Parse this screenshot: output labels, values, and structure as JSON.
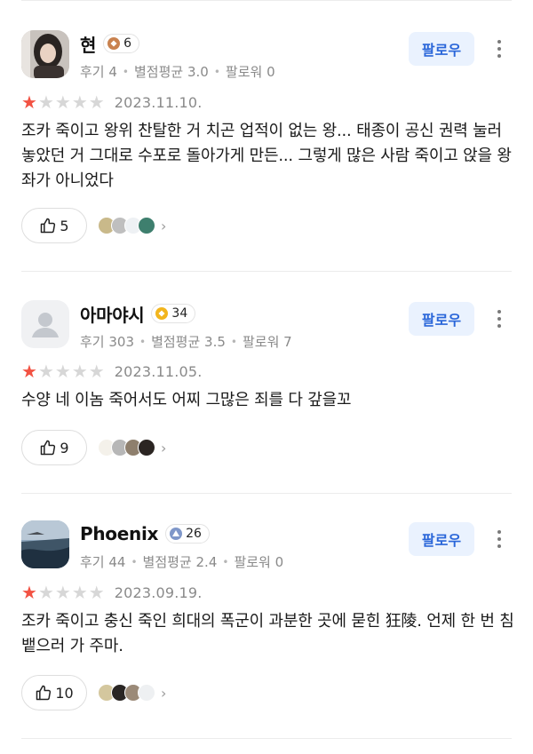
{
  "reviews": [
    {
      "username": "현",
      "level": "6",
      "level_color": "#c9824f",
      "stats": {
        "reviews": "후기 4",
        "avg": "별점평균 3.0",
        "followers": "팔로워 0"
      },
      "follow_label": "팔로우",
      "rating": 1,
      "date": "2023.11.10.",
      "text": "조카 죽이고 왕위 찬탈한 거 치곤 업적이 없는 왕... 태종이 공신 권력 눌러놓았던 거 그대로 수포로 돌아가게 만든... 그렇게 많은 사람 죽이고 앉을 왕좌가 아니었다",
      "likes": "5"
    },
    {
      "username": "아마야시",
      "level": "34",
      "level_color": "#f2b51d",
      "stats": {
        "reviews": "후기 303",
        "avg": "별점평균 3.5",
        "followers": "팔로워 7"
      },
      "follow_label": "팔로우",
      "rating": 1,
      "date": "2023.11.05.",
      "text": "수양 네 이놈 죽어서도 어찌 그많은 죄를 다 갚을꼬",
      "likes": "9"
    },
    {
      "username": "Phoenix",
      "level": "26",
      "level_color": "#7f97c9",
      "stats": {
        "reviews": "후기 44",
        "avg": "별점평균 2.4",
        "followers": "팔로워 0"
      },
      "follow_label": "팔로우",
      "rating": 1,
      "date": "2023.09.19.",
      "text": "조카 죽이고 충신 죽인 희대의 폭군이 과분한 곳에 묻힌 狂陵. 언제 한 번 침뱉으러 가 주마.",
      "likes": "10"
    }
  ],
  "colors": {
    "star_on": "#f25243",
    "star_off": "#d7d7d7",
    "follow_text": "#2a66d9",
    "follow_bg": "#eaf2fe"
  },
  "icons": {
    "like": "thumbs-up-icon",
    "more": "more-vertical-icon",
    "chevron": "chevron-right-icon"
  }
}
